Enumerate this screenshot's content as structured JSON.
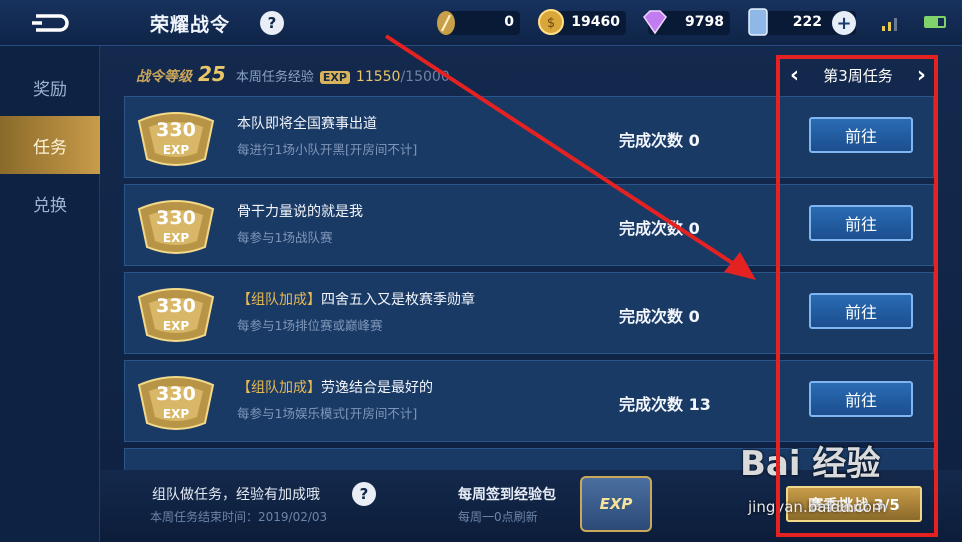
{
  "header": {
    "title": "荣耀战令",
    "help": "?",
    "resources": [
      {
        "icon": "feather-token-icon",
        "value": "0"
      },
      {
        "icon": "gold-coin-icon",
        "value": "19460"
      },
      {
        "icon": "diamond-icon",
        "value": "9798"
      },
      {
        "icon": "voucher-icon",
        "value": "222"
      }
    ],
    "add": "+"
  },
  "sidebar": {
    "items": [
      {
        "label": "奖励",
        "active": false
      },
      {
        "label": "任务",
        "active": true
      },
      {
        "label": "兑换",
        "active": false
      }
    ]
  },
  "level": {
    "label": "战令等级",
    "value": "25",
    "weekly_label": "本周任务经验",
    "exp_badge": "EXP",
    "current": "11550",
    "max": "/15000"
  },
  "week_nav": {
    "prev": "‹",
    "label": "第3周任务",
    "next": "›"
  },
  "tasks": [
    {
      "exp": "330",
      "exp_label": "EXP",
      "tag": "",
      "title": "本队即将全国赛事出道",
      "desc": "每进行1场小队开黑[开房间不计]",
      "count_label": "完成次数",
      "count": "0",
      "button": "前往"
    },
    {
      "exp": "330",
      "exp_label": "EXP",
      "tag": "",
      "title": "骨干力量说的就是我",
      "desc": "每参与1场战队赛",
      "count_label": "完成次数",
      "count": "0",
      "button": "前往"
    },
    {
      "exp": "330",
      "exp_label": "EXP",
      "tag": "【组队加成】",
      "title": "四舍五入又是枚赛季勋章",
      "desc": "每参与1场排位赛或巅峰赛",
      "count_label": "完成次数",
      "count": "0",
      "button": "前往"
    },
    {
      "exp": "330",
      "exp_label": "EXP",
      "tag": "【组队加成】",
      "title": "劳逸结合是最好的",
      "desc": "每参与1场娱乐模式[开房间不计]",
      "count_label": "完成次数",
      "count": "13",
      "button": "前往"
    }
  ],
  "footer": {
    "tip": "组队做任务，经验有加成哦",
    "help": "?",
    "end_time": "本周任务结束时间：2019/02/03",
    "signin_title": "每周签到经验包",
    "signin_sub": "每周一0点刷新",
    "chest_label": "EXP",
    "season_button": "赛季挑战 3/5"
  },
  "watermark": {
    "text": "Bai 经验",
    "url": "jingyan.baidu.com"
  },
  "colors": {
    "accent_gold": "#e9b94f",
    "button_blue": "#2a6bb3",
    "highlight_red": "#e42222"
  }
}
